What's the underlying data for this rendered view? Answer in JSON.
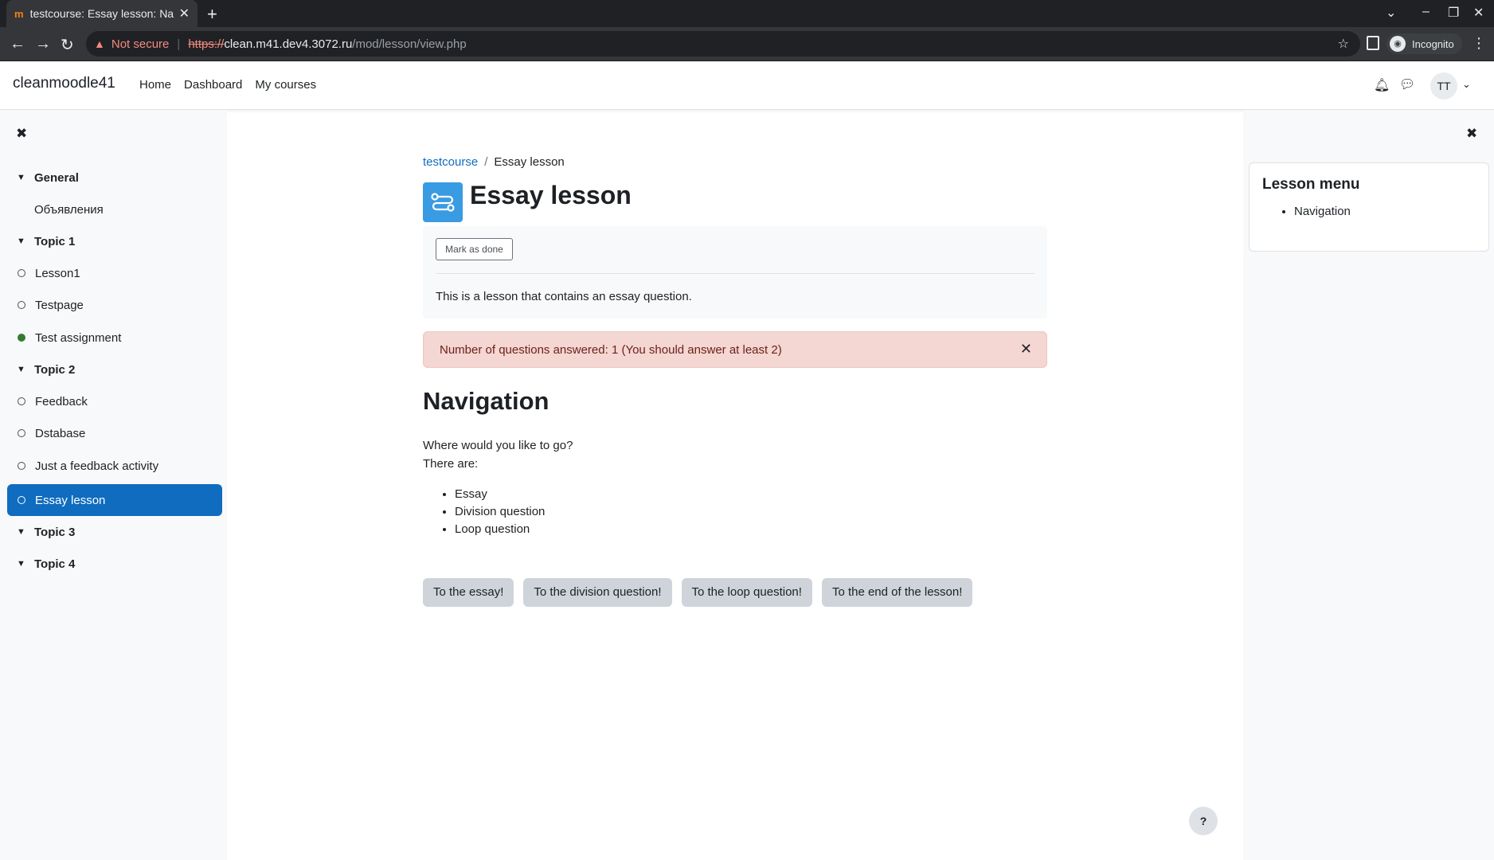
{
  "browser": {
    "tab_title": "testcourse: Essay lesson: Na",
    "security_label": "Not secure",
    "url_scheme": "https://",
    "url_host": "clean.m41.dev4.3072.ru",
    "url_path": "/mod/lesson/view.php",
    "incognito_label": "Incognito"
  },
  "navbar": {
    "brand": "cleanmoodle41",
    "links": [
      "Home",
      "Dashboard",
      "My courses"
    ],
    "user_initials": "TT"
  },
  "course_index": {
    "items": [
      {
        "label": "General",
        "kind": "section"
      },
      {
        "label": "Объявления",
        "kind": "activity-plain"
      },
      {
        "label": "Topic 1",
        "kind": "section"
      },
      {
        "label": "Lesson1",
        "kind": "activity"
      },
      {
        "label": "Testpage",
        "kind": "activity"
      },
      {
        "label": "Test assignment",
        "kind": "activity-done"
      },
      {
        "label": "Topic 2",
        "kind": "section"
      },
      {
        "label": "Feedback",
        "kind": "activity"
      },
      {
        "label": "Dstabase",
        "kind": "activity"
      },
      {
        "label": "Just a feedback activity",
        "kind": "activity"
      },
      {
        "label": "Essay lesson",
        "kind": "activity-active"
      },
      {
        "label": "Topic 3",
        "kind": "section"
      },
      {
        "label": "Topic 4",
        "kind": "section"
      }
    ]
  },
  "breadcrumb": {
    "course": "testcourse",
    "separator": "/",
    "current": "Essay lesson"
  },
  "page": {
    "title": "Essay lesson",
    "mark_done": "Mark as done",
    "description": "This is a lesson that contains an essay question.",
    "alert": "Number of questions answered: 1 (You should answer at least 2)",
    "nav_heading": "Navigation",
    "question": "Where would you like to go?",
    "there_are": "There are:",
    "options": [
      "Essay",
      "Division question",
      "Loop question"
    ],
    "buttons": [
      "To the essay!",
      "To the division question!",
      "To the loop question!",
      "To the end of the lesson!"
    ]
  },
  "lesson_menu": {
    "title": "Lesson menu",
    "items": [
      "Navigation"
    ]
  },
  "help_label": "?"
}
